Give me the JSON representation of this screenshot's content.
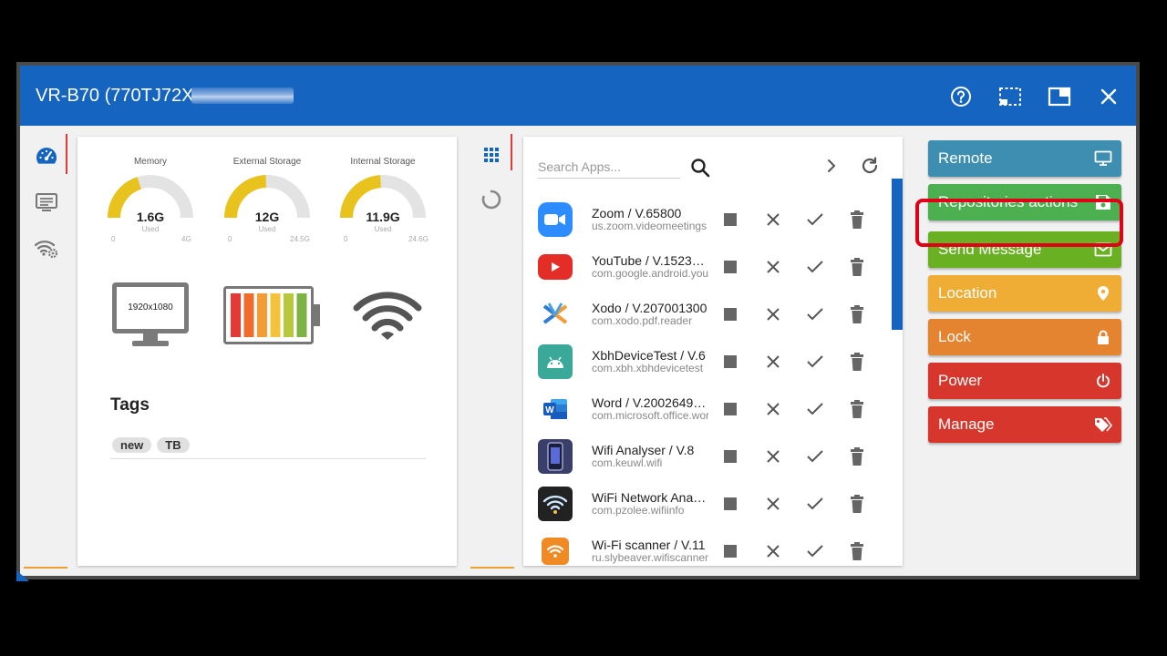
{
  "window": {
    "title": "VR-B70 (770TJ72X"
  },
  "status": {
    "gauges": [
      {
        "label": "Memory",
        "value": "1.6G",
        "used_label": "Used",
        "min": "0",
        "max": "4G",
        "fraction": 0.4,
        "color": "#e8c31e"
      },
      {
        "label": "External Storage",
        "value": "12G",
        "used_label": "Used",
        "min": "0",
        "max": "24.5G",
        "fraction": 0.49,
        "color": "#e8c31e"
      },
      {
        "label": "Internal Storage",
        "value": "11.9G",
        "used_label": "Used",
        "min": "0",
        "max": "24.6G",
        "fraction": 0.48,
        "color": "#e8c31e"
      }
    ],
    "resolution": "1920x1080",
    "battery_colors": [
      "#e53935",
      "#ef6c2d",
      "#f39c35",
      "#f5c33b",
      "#b8c83c",
      "#7cb342"
    ],
    "tags_title": "Tags",
    "tags": [
      "new",
      "TB"
    ]
  },
  "apps": {
    "search_placeholder": "Search Apps...",
    "list": [
      {
        "name": "Zoom / V.65800",
        "package": "us.zoom.videomeetings",
        "icon": "zoom-icon"
      },
      {
        "name": "YouTube / V.1523…",
        "package": "com.google.android.youtube",
        "icon": "youtube-icon"
      },
      {
        "name": "Xodo / V.207001300",
        "package": "com.xodo.pdf.reader",
        "icon": "xodo-icon"
      },
      {
        "name": "XbhDeviceTest / V.6",
        "package": "com.xbh.xbhdevicetest",
        "icon": "android-icon"
      },
      {
        "name": "Word / V.2002649…",
        "package": "com.microsoft.office.word",
        "icon": "word-icon"
      },
      {
        "name": "Wifi Analyser / V.8",
        "package": "com.keuwl.wifi",
        "icon": "wifi-analyser-icon"
      },
      {
        "name": "WiFi Network Ana…",
        "package": "com.pzolee.wifiinfo",
        "icon": "wifi-network-icon"
      },
      {
        "name": "Wi-Fi scanner / V.11",
        "package": "ru.slybeaver.wifiscanner",
        "icon": "wifi-scanner-icon"
      }
    ]
  },
  "actions": [
    {
      "label": "Remote",
      "color": "#3d8eb0",
      "icon": "monitor-icon",
      "name": "remote-button"
    },
    {
      "label": "Repositories actions",
      "color": "#4caf50",
      "icon": "save-icon",
      "name": "repositories-actions-button"
    },
    {
      "label": "Send Message",
      "color": "#6ab023",
      "icon": "mail-icon",
      "name": "send-message-button"
    },
    {
      "label": "Location",
      "color": "#f0ad35",
      "icon": "location-pin-icon",
      "name": "location-button"
    },
    {
      "label": "Lock",
      "color": "#e48330",
      "icon": "lock-icon",
      "name": "lock-button"
    },
    {
      "label": "Power",
      "color": "#d6362b",
      "icon": "power-icon",
      "name": "power-button"
    },
    {
      "label": "Manage",
      "color": "#d6362b",
      "icon": "tags-icon",
      "name": "manage-button"
    }
  ]
}
